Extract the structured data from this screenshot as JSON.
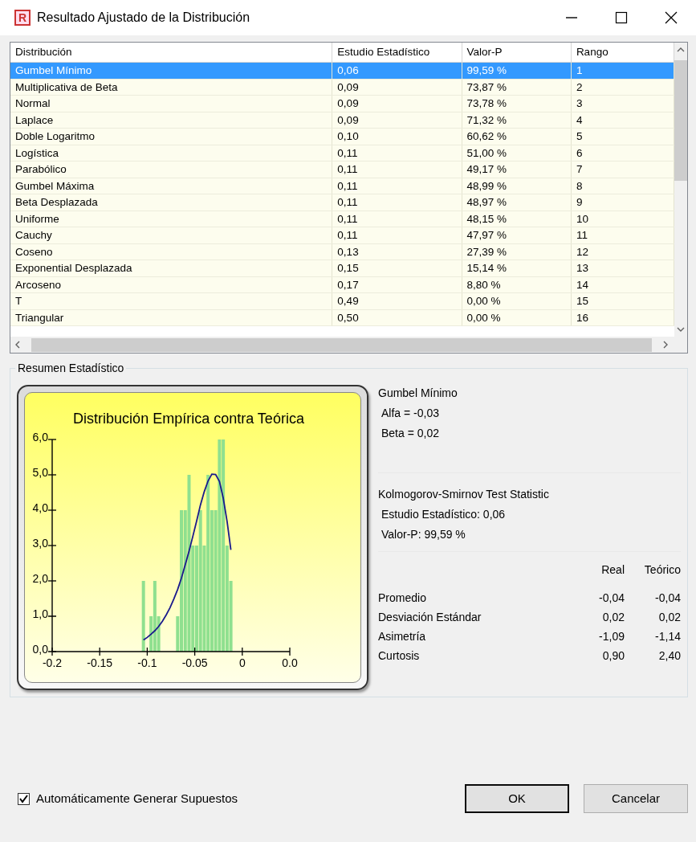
{
  "window": {
    "icon_letter": "R",
    "title": "Resultado Ajustado de la Distribución"
  },
  "table": {
    "columns": [
      "Distribución",
      "Estudio Estadístico",
      "Valor-P",
      "Rango"
    ],
    "rows": [
      {
        "cells": [
          "Gumbel Mínimo",
          "0,06",
          "99,59 %",
          "1"
        ],
        "selected": true
      },
      {
        "cells": [
          "Multiplicativa de Beta",
          "0,09",
          "73,87 %",
          "2"
        ],
        "selected": false
      },
      {
        "cells": [
          "Normal",
          "0,09",
          "73,78 %",
          "3"
        ],
        "selected": false
      },
      {
        "cells": [
          "Laplace",
          "0,09",
          "71,32 %",
          "4"
        ],
        "selected": false
      },
      {
        "cells": [
          "Doble Logaritmo",
          "0,10",
          "60,62 %",
          "5"
        ],
        "selected": false
      },
      {
        "cells": [
          "Logística",
          "0,11",
          "51,00 %",
          "6"
        ],
        "selected": false
      },
      {
        "cells": [
          "Parabólico",
          "0,11",
          "49,17 %",
          "7"
        ],
        "selected": false
      },
      {
        "cells": [
          "Gumbel Máxima",
          "0,11",
          "48,99 %",
          "8"
        ],
        "selected": false
      },
      {
        "cells": [
          "Beta Desplazada",
          "0,11",
          "48,97 %",
          "9"
        ],
        "selected": false
      },
      {
        "cells": [
          "Uniforme",
          "0,11",
          "48,15 %",
          "10"
        ],
        "selected": false
      },
      {
        "cells": [
          "Cauchy",
          "0,11",
          "47,97 %",
          "11"
        ],
        "selected": false
      },
      {
        "cells": [
          "Coseno",
          "0,13",
          "27,39 %",
          "12"
        ],
        "selected": false
      },
      {
        "cells": [
          "Exponential Desplazada",
          "0,15",
          "15,14 %",
          "13"
        ],
        "selected": false
      },
      {
        "cells": [
          "Arcoseno",
          "0,17",
          "8,80 %",
          "14"
        ],
        "selected": false
      },
      {
        "cells": [
          "T",
          "0,49",
          "0,00 %",
          "15"
        ],
        "selected": false
      },
      {
        "cells": [
          "Triangular",
          "0,50",
          "0,00 %",
          "16"
        ],
        "selected": false
      }
    ]
  },
  "summary": {
    "title": "Resumen Estadístico",
    "chart_data": {
      "type": "bar",
      "title": "Distribución Empírica contra Teórica",
      "x": [
        -0.104,
        -0.1,
        -0.096,
        -0.092,
        -0.088,
        -0.084,
        -0.08,
        -0.076,
        -0.072,
        -0.068,
        -0.064,
        -0.06,
        -0.056,
        -0.052,
        -0.048,
        -0.044,
        -0.04,
        -0.036,
        -0.032,
        -0.028,
        -0.024,
        -0.02,
        -0.016,
        -0.012
      ],
      "series": [
        {
          "color": "#8fe08f",
          "values": [
            2,
            null,
            1,
            2,
            1,
            null,
            null,
            null,
            null,
            1,
            4,
            4,
            5,
            3,
            3,
            4,
            3,
            5,
            4,
            4,
            6,
            6,
            3,
            2
          ]
        },
        {
          "type": "line",
          "color": "#1a1a8c",
          "values": [
            0.33,
            0.4,
            0.49,
            0.59,
            0.71,
            0.86,
            1.04,
            1.24,
            1.49,
            1.76,
            2.08,
            2.46,
            2.84,
            3.26,
            3.7,
            4.15,
            4.52,
            4.83,
            5.02,
            5.01,
            4.81,
            4.34,
            3.68,
            2.88
          ]
        }
      ],
      "xlim": [
        -0.2,
        0.05
      ],
      "ylim": [
        0,
        6
      ],
      "xticks": [
        {
          "value": -0.2,
          "label": "-0.2"
        },
        {
          "value": -0.15,
          "label": "-0.15"
        },
        {
          "value": -0.1,
          "label": "-0.1"
        },
        {
          "value": -0.05,
          "label": "-0.05"
        },
        {
          "value": 0,
          "label": "0"
        },
        {
          "value": 0.05,
          "label": "0.0"
        }
      ],
      "yticks": [
        {
          "value": 0,
          "label": "0,0"
        },
        {
          "value": 1,
          "label": "1,0"
        },
        {
          "value": 2,
          "label": "2,0"
        },
        {
          "value": 3,
          "label": "3,0"
        },
        {
          "value": 4,
          "label": "4,0"
        },
        {
          "value": 5,
          "label": "5,0"
        },
        {
          "value": 6,
          "label": "6,0"
        }
      ]
    },
    "distribution": "Gumbel Mínimo",
    "params": [
      "Alfa = -0,03",
      "Beta = 0,02"
    ],
    "test": {
      "title": "Kolmogorov-Smirnov Test Statistic",
      "lines": [
        "Estudio Estadístico: 0,06",
        "Valor-P: 99,59 %"
      ]
    },
    "stats": {
      "columns": [
        "Real",
        "Teórico"
      ],
      "rows": [
        {
          "label": "Promedio",
          "values": [
            "-0,04",
            "-0,04"
          ]
        },
        {
          "label": "Desviación Estándar",
          "values": [
            "0,02",
            "0,02"
          ]
        },
        {
          "label": "Asimetría",
          "values": [
            "-1,09",
            "-1,14"
          ]
        },
        {
          "label": "Curtosis",
          "values": [
            "0,90",
            "2,40"
          ]
        }
      ]
    }
  },
  "auto_generate": {
    "label": "Automáticamente Generar Supuestos",
    "checked": true
  },
  "buttons": [
    {
      "label": "OK",
      "default": true
    },
    {
      "label": "Cancelar",
      "default": false
    }
  ]
}
